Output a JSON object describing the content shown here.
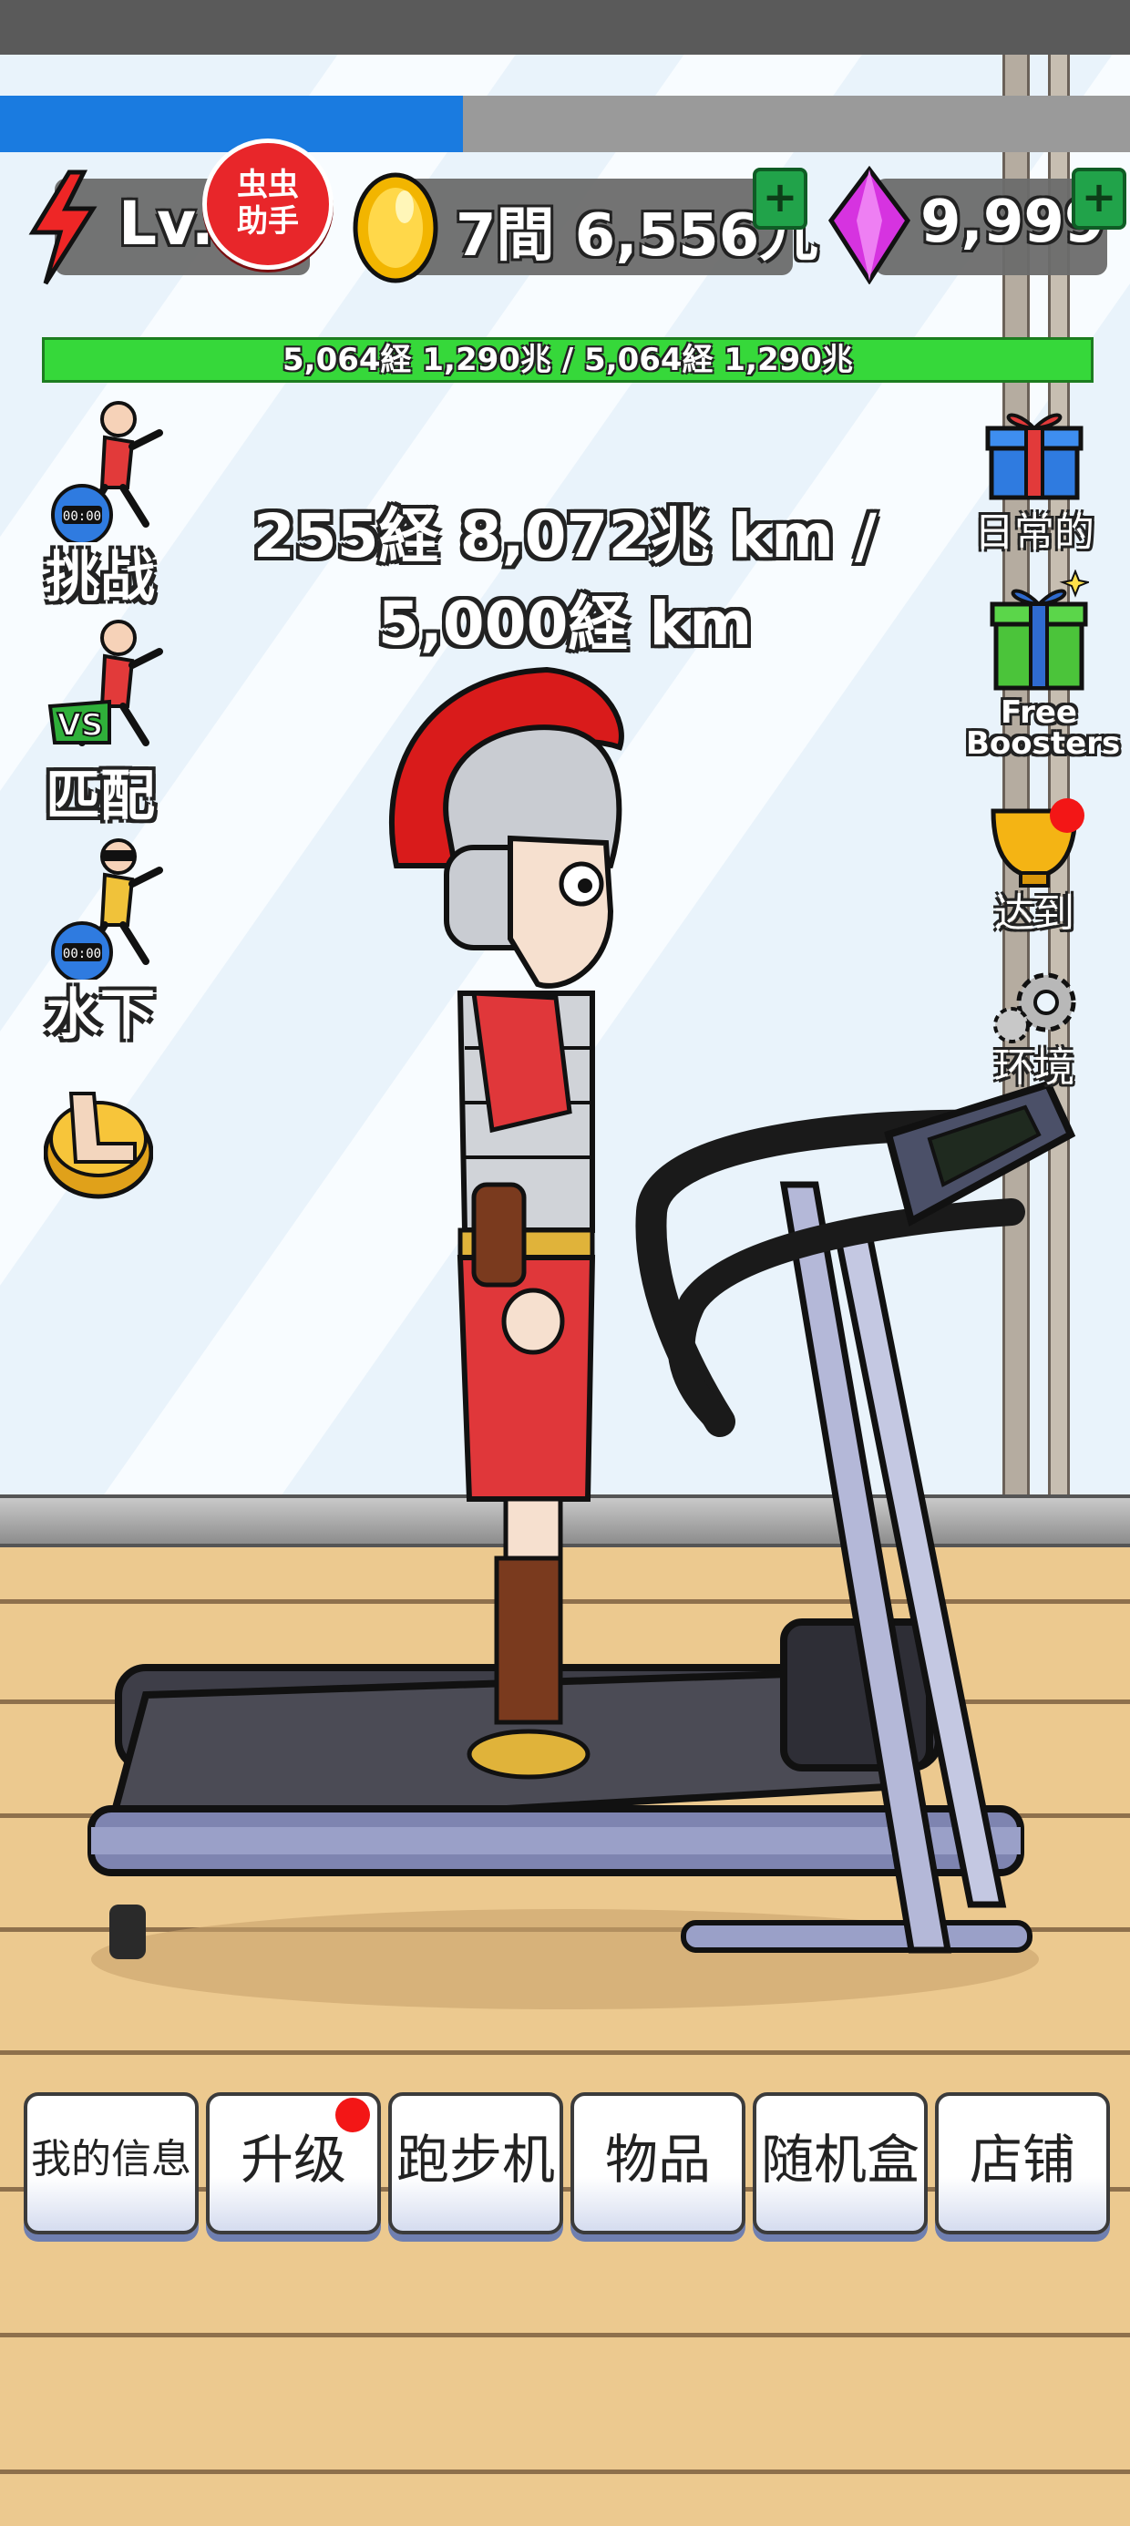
{
  "header": {
    "level_label": "Lv.1",
    "assistant_badge_line1": "虫虫",
    "assistant_badge_line2": "助手",
    "coins": "7間 6,556九",
    "gems": "9,999",
    "stamina_progress_fraction": 0.41
  },
  "hp_bar": {
    "text": "5,064経 1,290兆 / 5,064経 1,290兆"
  },
  "distance": {
    "text": "255経 8,072兆 km / 5,000経 km"
  },
  "left_menu": {
    "challenge": "挑战",
    "vs_badge": "VS",
    "match": "匹配",
    "underwater": "水下",
    "timer_text": "00:00"
  },
  "right_menu": {
    "daily": "日常的",
    "free_boosters_line1": "Free",
    "free_boosters_line2": "Boosters",
    "achievement": "达到",
    "environment": "环境"
  },
  "bottom_menu": [
    {
      "label": "我的信息",
      "has_dot": false
    },
    {
      "label": "升级",
      "has_dot": true
    },
    {
      "label": "跑步机",
      "has_dot": false
    },
    {
      "label": "物品",
      "has_dot": false
    },
    {
      "label": "随机盒",
      "has_dot": false
    },
    {
      "label": "店铺",
      "has_dot": false
    }
  ],
  "colors": {
    "hp_green": "#36d83a",
    "progress_blue": "#1a7be0",
    "badge_red": "#e8262a",
    "notification_red": "#f31616"
  }
}
